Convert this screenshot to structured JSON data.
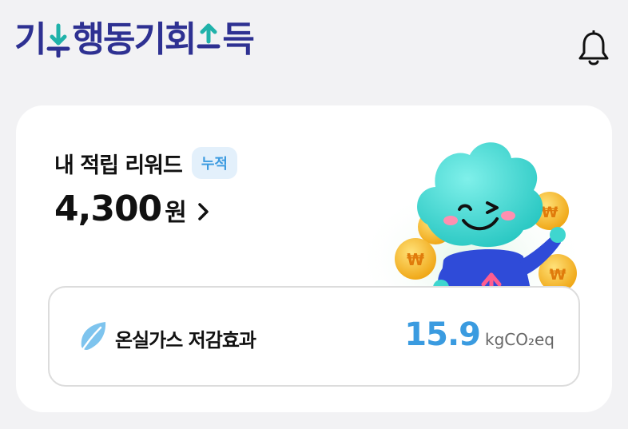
{
  "header": {
    "logo_parts": [
      "기",
      "행동",
      "기회",
      "득"
    ],
    "colors": {
      "brand": "#2e3192",
      "accent": "#20b2aa"
    },
    "notification_icon": "bell-icon"
  },
  "reward_card": {
    "title": "내 적립 리워드",
    "badge": "누적",
    "amount": "4,300",
    "amount_unit": "원",
    "chevron_icon": "chevron-right-icon",
    "mascot": "mascot-illustration"
  },
  "ghg": {
    "icon": "leaf-icon",
    "label": "온실가스 저감효과",
    "value": "15.9",
    "unit": "kgCO₂eq",
    "value_color": "#3a9be0"
  }
}
